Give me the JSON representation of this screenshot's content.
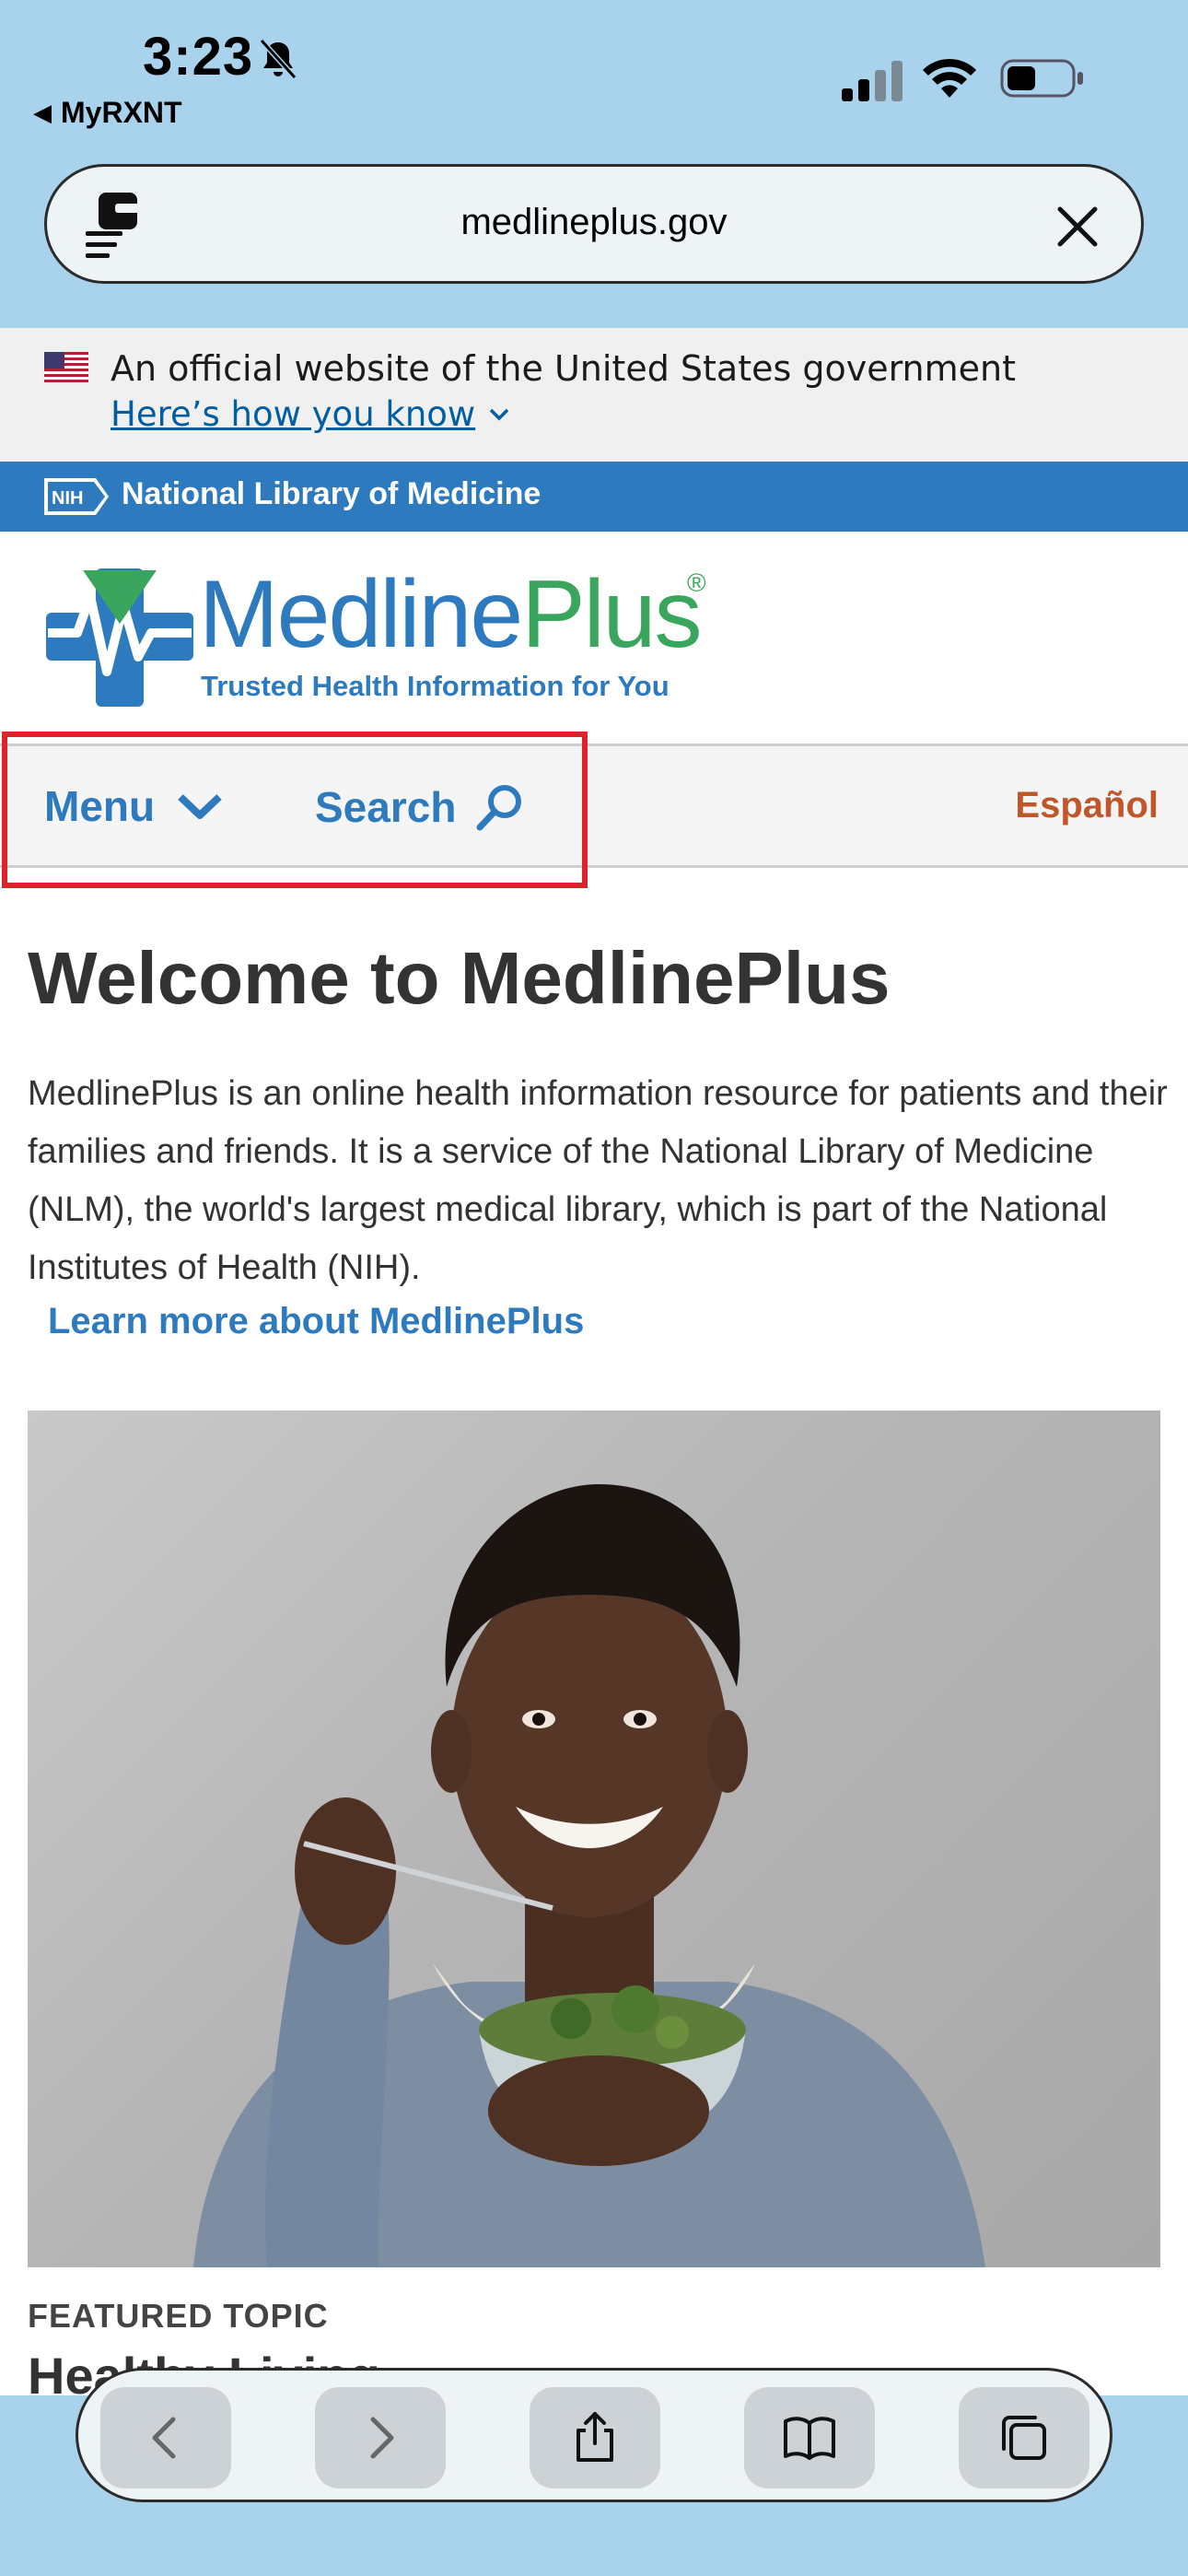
{
  "status_bar": {
    "time": "3:23",
    "back_app": "MyRXNT"
  },
  "browser": {
    "url": "medlineplus.gov"
  },
  "gov_banner": {
    "text": "An official website of the United States government",
    "link": "Here’s how you know"
  },
  "nlm": {
    "badge": "NIH",
    "name": "National Library of Medicine"
  },
  "brand": {
    "name_part1": "Medline",
    "name_part2": "Plus",
    "registered": "®",
    "tagline": "Trusted Health Information for You"
  },
  "nav": {
    "menu_label": "Menu",
    "search_label": "Search",
    "language_label": "Español"
  },
  "main": {
    "title": "Welcome to MedlinePlus",
    "intro": "MedlinePlus is an online health information resource for patients and their families and friends. It is a service of the National Library of Medicine (NLM), the world's largest medical library, which is part of the National Institutes of Health (NIH).",
    "learn_more": "Learn more about MedlinePlus",
    "featured_label": "FEATURED TOPIC",
    "featured_title": "Healthy Living"
  },
  "colors": {
    "brand_blue": "#2e7abf",
    "brand_green": "#3aa55c",
    "spanish_orange": "#c0572a",
    "highlight_red": "#e0202a",
    "sky": "#a9d3ec"
  },
  "icons": {
    "bell": "bell-slash-icon",
    "signal": "cellular-signal-icon",
    "wifi": "wifi-icon",
    "battery": "battery-icon",
    "reader": "reader-mode-icon",
    "close": "close-icon",
    "search": "search-icon",
    "chevron": "chevron-down-icon",
    "toolbar": [
      "back-arrow-icon",
      "forward-arrow-icon",
      "share-icon",
      "bookmarks-icon",
      "tabs-icon"
    ]
  }
}
